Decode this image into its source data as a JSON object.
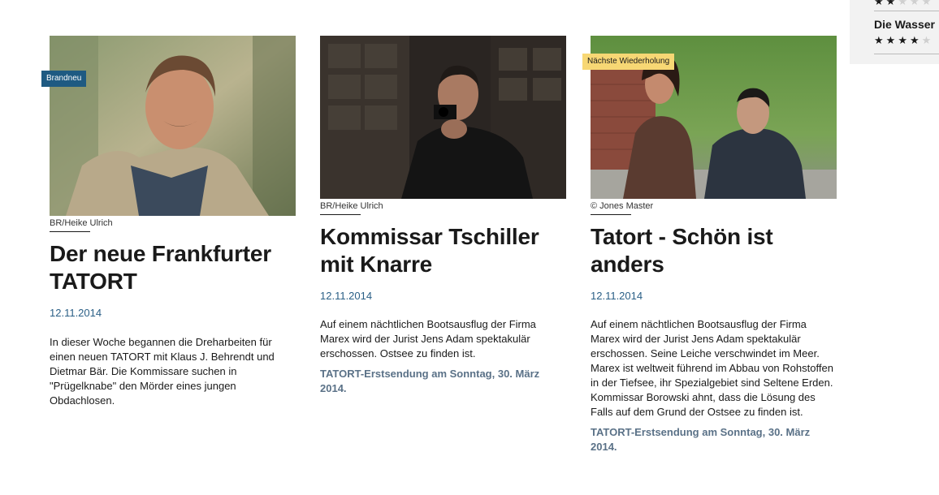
{
  "side_panel": {
    "item_title": "Die Wasser",
    "rating_top": {
      "filled": 2,
      "total": 5
    },
    "rating_item": {
      "filled": 4,
      "total": 5
    }
  },
  "cards": [
    {
      "badge": "Brandneu",
      "credit": "BR/Heike Ulrich",
      "title": "Der neue Frankfurter TATORT",
      "date": "12.11.2014",
      "description": "In dieser Woche begannen die Dreharbeiten für einen neuen TATORT mit Klaus J. Behrendt und Dietmar Bär. Die Kommissare suchen in \"Prügelknabe\" den Mörder eines jungen Obdachlosen.",
      "airing": ""
    },
    {
      "badge": "",
      "credit": "BR/Heike Ulrich",
      "title": "Kommissar Tschiller mit Knarre",
      "date": "12.11.2014",
      "description": "Auf einem nächtlichen Bootsausflug der Firma Marex wird der Jurist Jens Adam spektakulär erschossen. Ostsee zu finden ist.",
      "airing": "TATORT-Erstsendung am Sonntag, 30. März 2014."
    },
    {
      "badge": "Nächste Wiederholung",
      "credit": "© Jones Master",
      "title": "Tatort - Schön ist anders",
      "date": "12.11.2014",
      "description": "Auf einem nächtlichen Bootsausflug der Firma Marex wird der Jurist Jens Adam spektakulär erschossen. Seine Leiche verschwindet im Meer. Marex ist weltweit führend im Abbau von Rohstoffen in der Tiefsee, ihr Spezialgebiet sind Seltene Erden. Kommissar Borowski ahnt, dass die Lösung des Falls auf dem Grund der Ostsee zu finden ist.",
      "airing": "TATORT-Erstsendung am Sonntag, 30. März 2014."
    }
  ]
}
